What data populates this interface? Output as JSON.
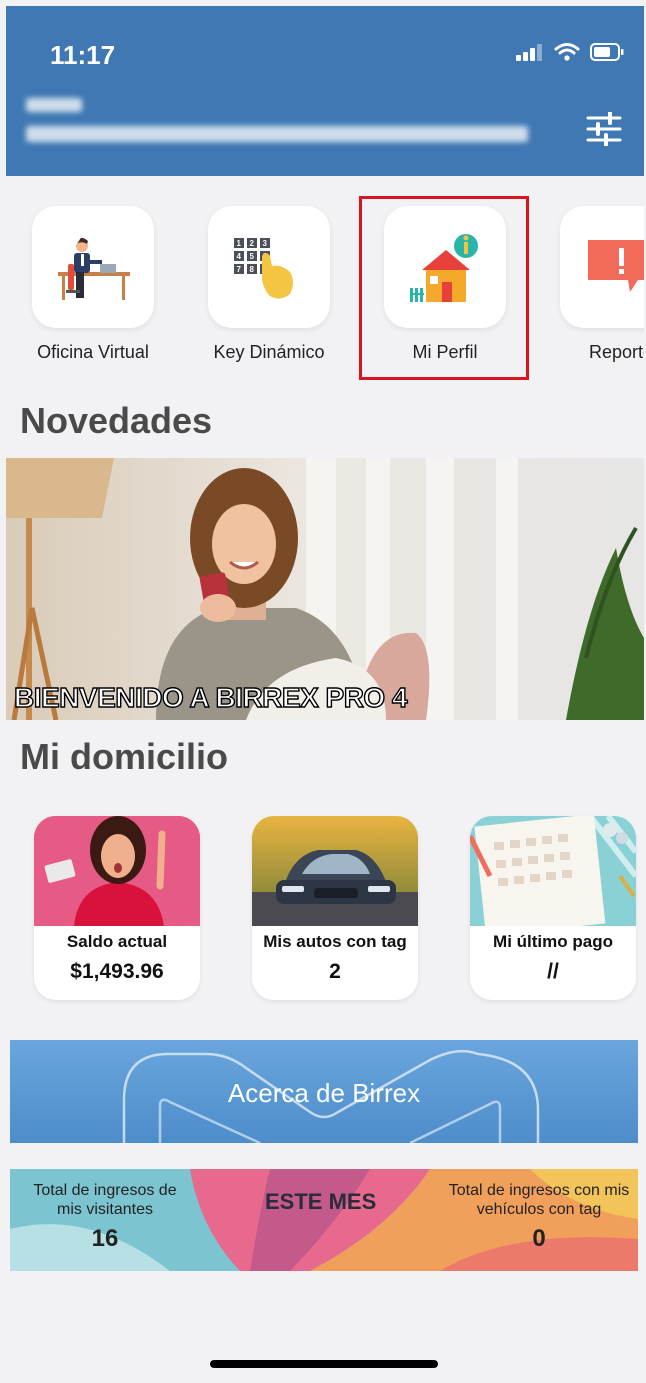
{
  "status_bar": {
    "time": "11:17"
  },
  "shortcuts": [
    {
      "label": "Oficina Virtual",
      "icon": "office-desk-icon"
    },
    {
      "label": "Key Dinámico",
      "icon": "keypad-hand-icon"
    },
    {
      "label": "Mi Perfil",
      "icon": "house-info-icon"
    },
    {
      "label": "Reporte",
      "icon": "alert-speech-icon"
    }
  ],
  "keypad_digits": [
    "1",
    "2",
    "3",
    "4",
    "5",
    "6",
    "7",
    "8",
    "9"
  ],
  "sections": {
    "news_title": "Novedades",
    "home_title": "Mi domicilio"
  },
  "banner": {
    "caption": "BIENVENIDO A BIRREX PRO 4"
  },
  "cards": [
    {
      "title": "Saldo actual",
      "value": "$1,493.96"
    },
    {
      "title": "Mis autos con tag",
      "value": "2"
    },
    {
      "title": "Mi último pago",
      "value": "//"
    }
  ],
  "about": {
    "label": "Acerca de Birrex"
  },
  "stats": {
    "visitors_label": "Total de ingresos de mis visitantes",
    "visitors_value": "16",
    "period_label": "ESTE MES",
    "vehicles_label": "Total de ingresos con mis vehículos con tag",
    "vehicles_value": "0"
  },
  "colors": {
    "header": "#3f78b3",
    "highlight": "#d8151c",
    "background": "#f2f2f4"
  }
}
